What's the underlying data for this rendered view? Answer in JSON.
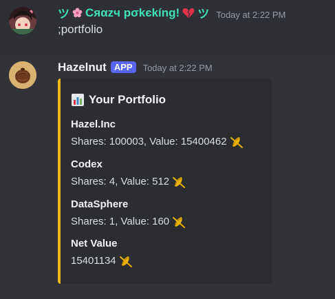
{
  "messages": [
    {
      "username_prefix": "ツ",
      "username_main": "Cяαzч pσkєkíng!",
      "username_suffix": "ツ",
      "timestamp": "Today at 2:22 PM",
      "content": ";portfolio",
      "name_color": "#3fe3b5"
    },
    {
      "username": "Hazelnut",
      "badge": "APP",
      "timestamp": "Today at 2:22 PM",
      "embed": {
        "title": "Your Portfolio",
        "title_icon": "bar-chart-icon",
        "accent_color": "#f0b919",
        "fields": [
          {
            "name": "Hazel.Inc",
            "value": "Shares: 100003, Value: 15400462"
          },
          {
            "name": "Codex",
            "value": "Shares: 4, Value: 512"
          },
          {
            "name": "DataSphere",
            "value": "Shares: 1, Value: 160"
          },
          {
            "name": "Net Value",
            "value": "15401134"
          }
        ],
        "currency_icon": "hazel-coin-icon"
      }
    }
  ],
  "colors": {
    "background": "#313338",
    "embed_background": "#2b2d31",
    "badge": "#5865f2",
    "timestamp": "#949ba4"
  }
}
